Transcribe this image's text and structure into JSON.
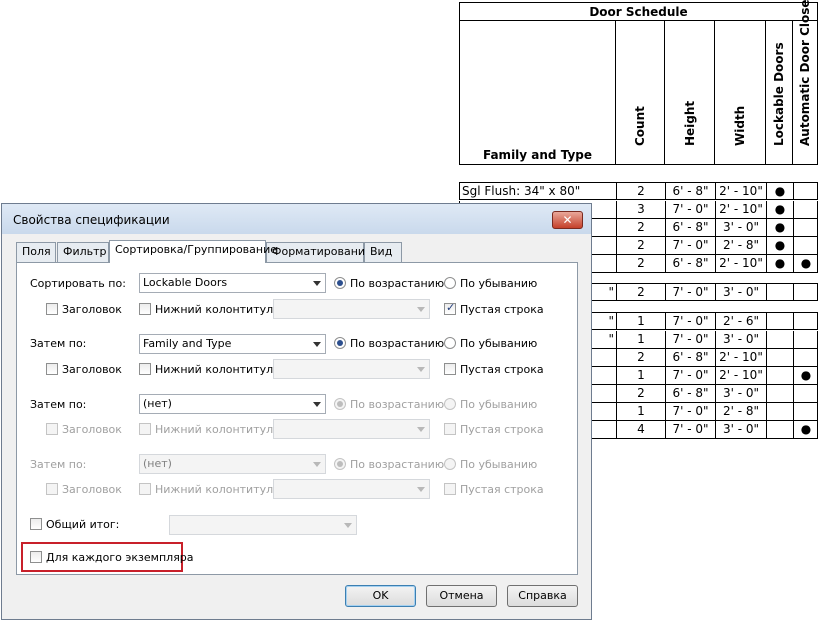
{
  "schedule": {
    "title": "Door Schedule",
    "columns": [
      "Family and Type",
      "Count",
      "Height",
      "Width",
      "Lockable Doors",
      "Automatic Door Closer"
    ],
    "rows": [
      {
        "family": "Sgl Flush: 34\" x 80\"",
        "count": "2",
        "height": "6' - 8\"",
        "width": "2' - 10\"",
        "lock": "●",
        "auto": ""
      },
      {
        "family": "",
        "count": "3",
        "height": "7' - 0\"",
        "width": "2' - 10\"",
        "lock": "●",
        "auto": ""
      },
      {
        "family": "",
        "count": "2",
        "height": "6' - 8\"",
        "width": "3' - 0\"",
        "lock": "●",
        "auto": ""
      },
      {
        "family": "",
        "count": "2",
        "height": "7' - 0\"",
        "width": "2' - 8\"",
        "lock": "●",
        "auto": ""
      },
      {
        "family": "",
        "count": "2",
        "height": "6' - 8\"",
        "width": "2' - 10\"",
        "lock": "●",
        "auto": "●"
      },
      {
        "family": "\"",
        "count": "2",
        "height": "7' - 0\"",
        "width": "3' - 0\"",
        "lock": "",
        "auto": ""
      },
      {
        "family": "\"",
        "count": "1",
        "height": "7' - 0\"",
        "width": "2' - 6\"",
        "lock": "",
        "auto": ""
      },
      {
        "family": "\"",
        "count": "1",
        "height": "7' - 0\"",
        "width": "3' - 0\"",
        "lock": "",
        "auto": ""
      },
      {
        "family": "",
        "count": "2",
        "height": "6' - 8\"",
        "width": "2' - 10\"",
        "lock": "",
        "auto": ""
      },
      {
        "family": "",
        "count": "1",
        "height": "7' - 0\"",
        "width": "2' - 10\"",
        "lock": "",
        "auto": "●"
      },
      {
        "family": "",
        "count": "2",
        "height": "6' - 8\"",
        "width": "3' - 0\"",
        "lock": "",
        "auto": ""
      },
      {
        "family": "",
        "count": "1",
        "height": "7' - 0\"",
        "width": "2' - 8\"",
        "lock": "",
        "auto": ""
      },
      {
        "family": "",
        "count": "4",
        "height": "7' - 0\"",
        "width": "3' - 0\"",
        "lock": "",
        "auto": "●"
      }
    ]
  },
  "dialog": {
    "title": "Свойства спецификации",
    "close_label": "✕",
    "tabs": [
      "Поля",
      "Фильтр",
      "Сортировка/Группирование",
      "Форматирование",
      "Вид"
    ],
    "sort_label": "Сортировать по:",
    "then_label": "Затем по:",
    "ascending": "По возрастанию",
    "descending": "По убыванию",
    "header": "Заголовок",
    "footer": "Нижний колонтитул:",
    "blank_line": "Пустая строка",
    "sort_by": "Lockable Doors",
    "then1": "Family and Type",
    "then2": "(нет)",
    "then3": "(нет)",
    "grand_total": "Общий итог:",
    "itemize": "Для каждого экземпляра",
    "ok": "OK",
    "cancel": "Отмена",
    "help": "Справка"
  }
}
